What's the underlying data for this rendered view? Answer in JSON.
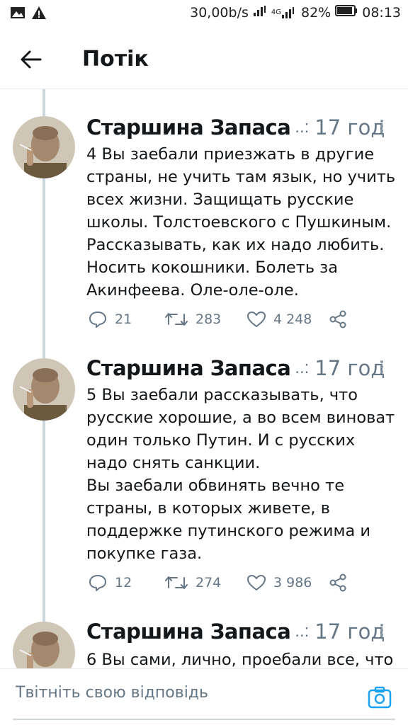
{
  "status_bar": {
    "speed": "30,00b/s",
    "network": "4G",
    "battery": "82%",
    "time": "08:13"
  },
  "header": {
    "title": "Потік",
    "back_icon": "arrow-left-icon"
  },
  "tweets": [
    {
      "author": "Старшина Запаса",
      "ellipsis": "..:",
      "time": "17 год",
      "text": "4 Вы заебали приезжать в другие страны, не учить там язык, но учить всех жизни. Защищать русские школы. Толстоевского с Пушкиным. Рассказывать, как их надо любить. Носить кокошники. Болеть за Акинфеева. Оле-оле-оле.",
      "replies": "21",
      "retweets": "283",
      "likes": "4 248"
    },
    {
      "author": "Старшина Запаса",
      "ellipsis": "..:",
      "time": "17 год",
      "text": "5 Вы заебали рассказывать, что русские хорошие, а во всем виноват один только Путин. И с русских надо снять санкции.\nВы заебали обвинять вечно те страны, в которых живете, в поддержке путинского режима и покупке газа.",
      "replies": "12",
      "retweets": "274",
      "likes": "3 986"
    },
    {
      "author": "Старшина Запаса",
      "ellipsis": "..:",
      "time": "17 год",
      "text": "6 Вы сами, лично, проебали все, что"
    }
  ],
  "reply_bar": {
    "placeholder": "Твітніть свою відповідь",
    "camera_icon": "camera-icon"
  },
  "colors": {
    "text": "#14171a",
    "secondary": "#657786",
    "accent": "#1da1f2",
    "thread_line": "#ccd6dd"
  }
}
